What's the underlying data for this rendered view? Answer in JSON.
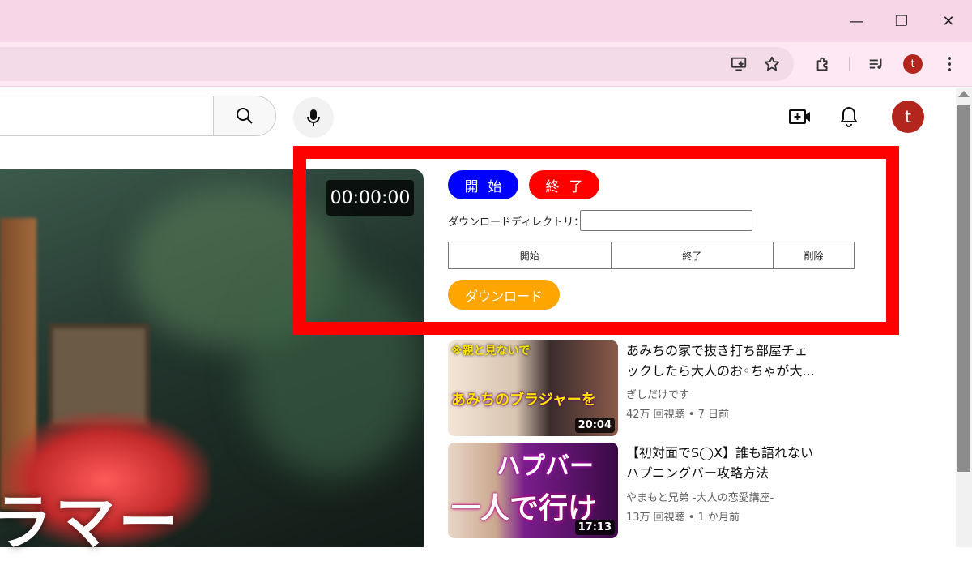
{
  "browser": {
    "window_controls": {
      "minimize": "—",
      "restore": "❐",
      "close": "✕"
    },
    "profile_initial": "t"
  },
  "youtube": {
    "search_placeholder": "",
    "account_initial": "t"
  },
  "player": {
    "timer": "00:00:00",
    "overlay_text": "ラマー"
  },
  "panel": {
    "start_label": "開始",
    "end_label": "終了",
    "directory_label": "ダウンロードディレクトリ：",
    "directory_value": "",
    "table_headers": [
      "開始",
      "終了",
      "削除"
    ],
    "download_label": "ダウンロード"
  },
  "recommendations": [
    {
      "title_line1": "あみちの家で抜き打ち部屋チェ",
      "title_line2": "ックしたら大人のお◦ちゃが大...",
      "channel": "ぎしだけです",
      "meta": "42万 回視聴 • 7 日前",
      "duration": "20:04",
      "thumb_text_top": "※親と見ないで",
      "thumb_text_bottom": "あみちのブラジャーを"
    },
    {
      "title_line1": "【初対面でS◯X】誰も語れない",
      "title_line2": "ハプニングバー攻略方法",
      "channel": "やまもと兄弟 -大人の恋愛講座-",
      "meta": "13万 回視聴 • 1 か月前",
      "duration": "17:13",
      "thumb_text_top": "ハプバー",
      "thumb_text_bottom": "一人で行け"
    }
  ],
  "colors": {
    "titlebar": "#f7d6e8",
    "start_button": "#0000ff",
    "end_button": "#ff0000",
    "download_button": "#ffa500",
    "highlight_frame": "#ff0000"
  }
}
